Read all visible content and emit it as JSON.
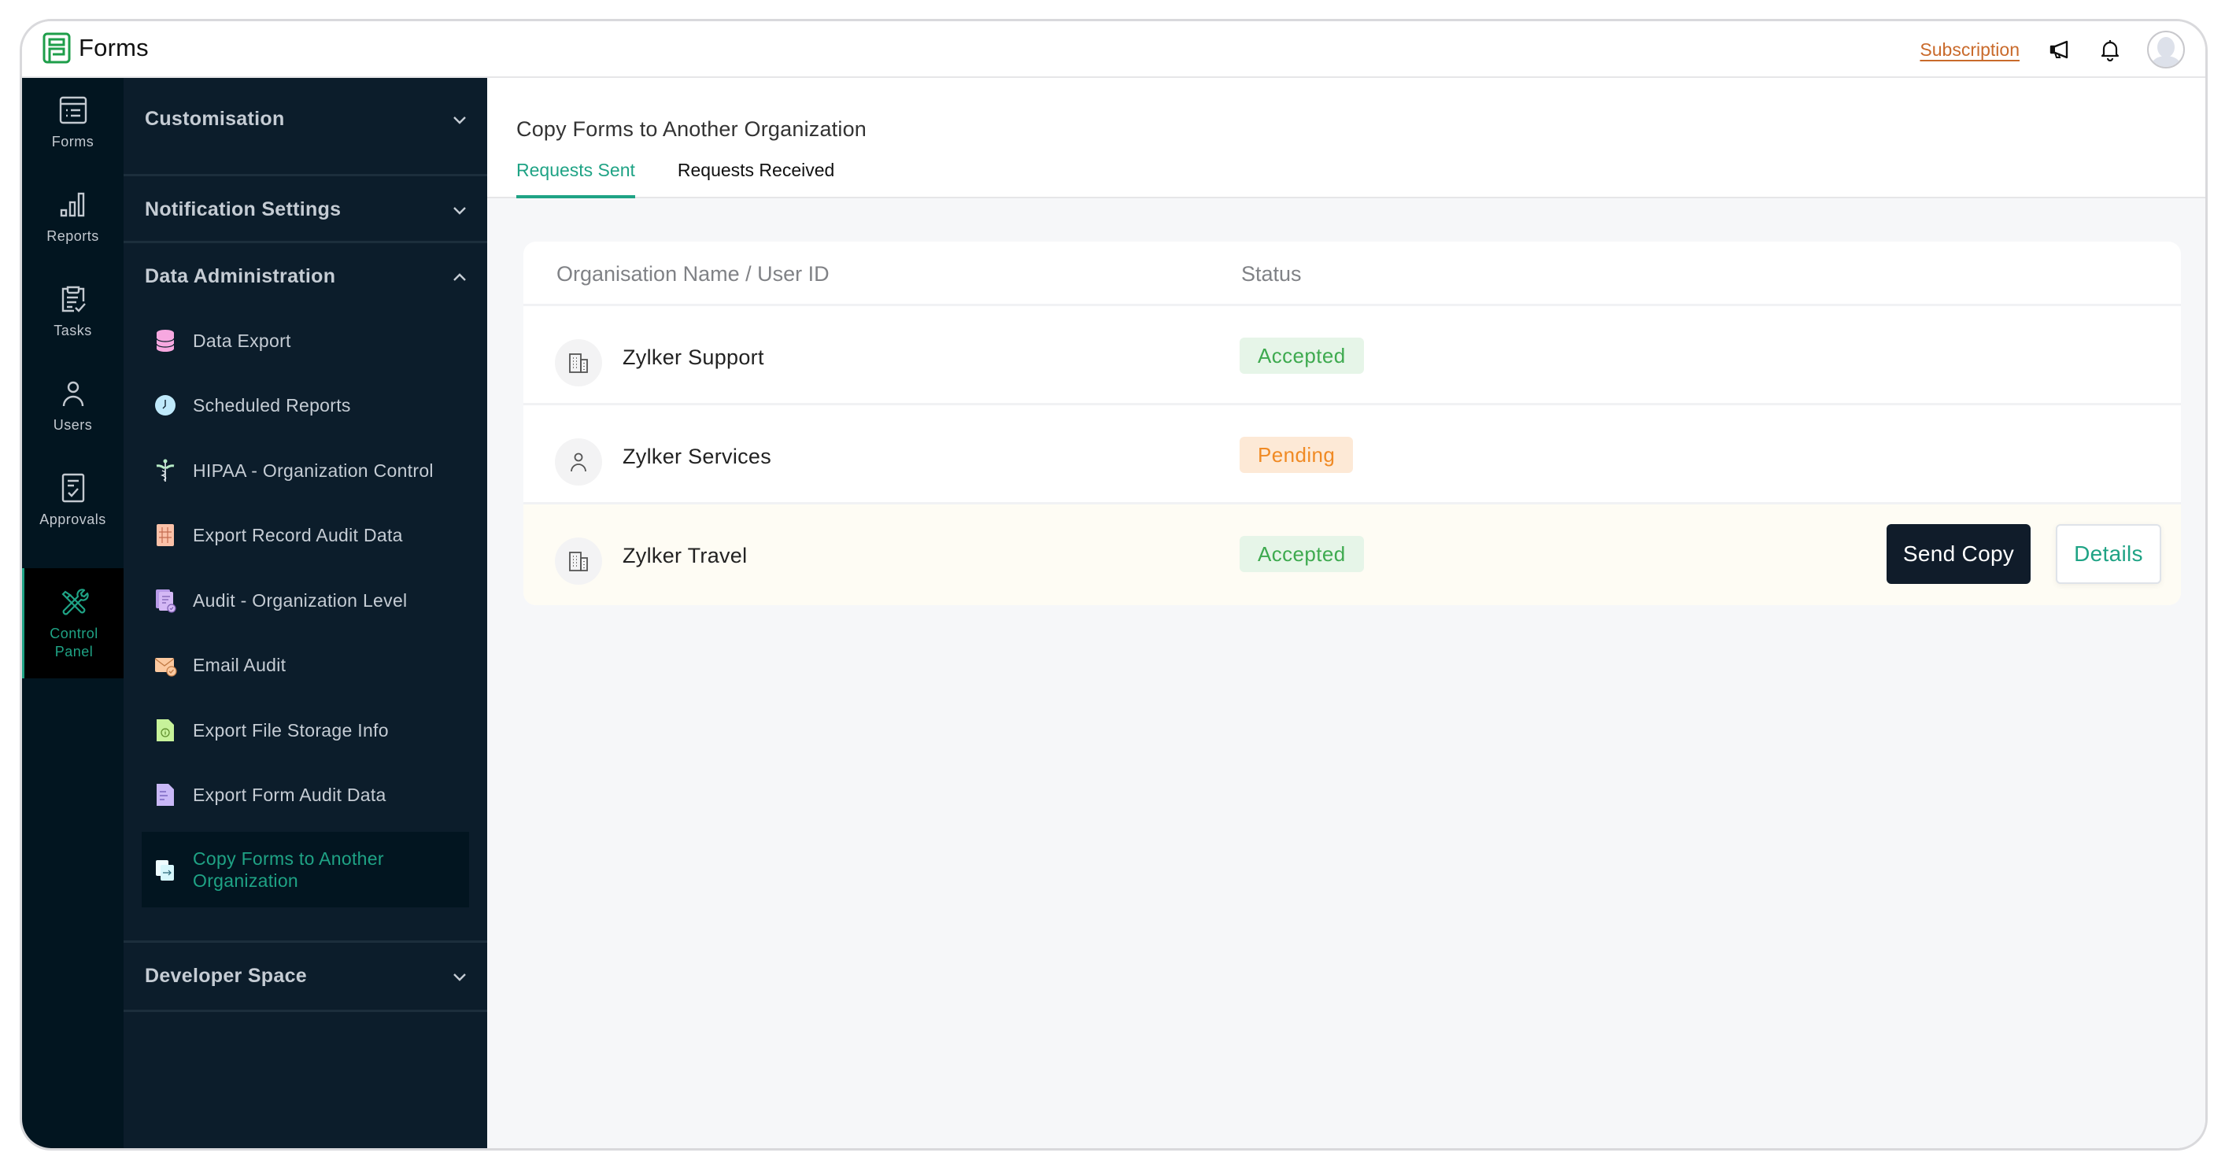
{
  "app": {
    "name": "Forms",
    "brand_color": "#1e9e4a"
  },
  "topbar": {
    "subscription_label": "Subscription",
    "icons": [
      "megaphone-icon",
      "bell-icon",
      "user-avatar"
    ]
  },
  "rail": {
    "items": [
      {
        "label": "Forms",
        "icon": "forms-icon",
        "active": false
      },
      {
        "label": "Reports",
        "icon": "bar-chart-icon",
        "active": false
      },
      {
        "label": "Tasks",
        "icon": "clipboard-check-icon",
        "active": false
      },
      {
        "label": "Users",
        "icon": "user-icon",
        "active": false
      },
      {
        "label": "Approvals",
        "icon": "approval-doc-icon",
        "active": false
      },
      {
        "label_line1": "Control",
        "label_line2": "Panel",
        "icon": "tools-icon",
        "active": true
      }
    ]
  },
  "sidebar": {
    "sections": [
      {
        "label": "Customisation",
        "expanded": false
      },
      {
        "label": "Notification Settings",
        "expanded": false
      },
      {
        "label": "Data Administration",
        "expanded": true
      },
      {
        "label": "Developer Space",
        "expanded": false
      }
    ],
    "data_admin_items": [
      {
        "label": "Data Export",
        "icon": "database-icon",
        "color": "#f7a8e0"
      },
      {
        "label": "Scheduled Reports",
        "icon": "clock-icon",
        "color": "#bfe9fb"
      },
      {
        "label": "HIPAA - Organization Control",
        "icon": "caduceus-icon",
        "color": "#b7ecc6"
      },
      {
        "label": "Export Record Audit Data",
        "icon": "table-doc-icon",
        "color": "#fbc1a8"
      },
      {
        "label": "Audit - Organization Level",
        "icon": "audit-docs-icon",
        "color": "#d4b8f5"
      },
      {
        "label": "Email Audit",
        "icon": "email-check-icon",
        "color": "#fbc9a0"
      },
      {
        "label": "Export File Storage Info",
        "icon": "file-info-icon",
        "color": "#c7f29a"
      },
      {
        "label": "Export Form Audit Data",
        "icon": "form-doc-icon",
        "color": "#c9b8f7"
      },
      {
        "label": "Copy Forms to Another Organization",
        "icon": "copy-forms-icon",
        "color": "#d6f6fb",
        "active": true
      }
    ]
  },
  "main": {
    "title": "Copy Forms to Another Organization",
    "tabs": [
      {
        "label": "Requests Sent",
        "active": true
      },
      {
        "label": "Requests Received",
        "active": false
      }
    ],
    "table": {
      "columns": [
        "Organisation Name / User ID",
        "Status"
      ],
      "rows": [
        {
          "name": "Zylker Support",
          "type": "organization",
          "status": "Accepted"
        },
        {
          "name": "Zylker Services",
          "type": "user",
          "status": "Pending"
        },
        {
          "name": "Zylker Travel",
          "type": "organization",
          "status": "Accepted",
          "highlighted": true,
          "actions": {
            "send_copy": "Send Copy",
            "details": "Details"
          }
        }
      ]
    }
  },
  "colors": {
    "accent": "#1fa385",
    "accepted_bg": "#e6f5e8",
    "accepted_text": "#3eaa4f",
    "pending_bg": "#fde9d6",
    "pending_text": "#f08a24",
    "sidebar_bg": "#0c1d2b",
    "rail_bg": "#021520",
    "subscription": "#c96a2b"
  }
}
